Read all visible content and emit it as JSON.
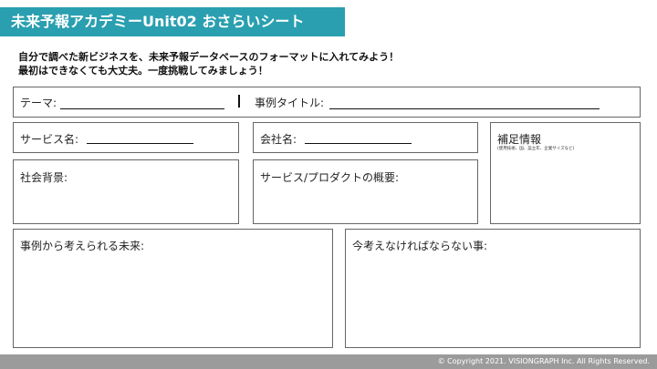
{
  "header": {
    "title": "未来予報アカデミーUnit02 おさらいシート"
  },
  "intro": {
    "line1": "自分で調べた新ビジネスを、未来予報データベースのフォーマットに入れてみよう！",
    "line2": "最初はできなくても大丈夫。一度挑戦してみましょう！"
  },
  "fields": {
    "theme": "テーマ:",
    "case_title": "事例タイトル:",
    "service_name": "サービス名:",
    "company_name": "会社名:",
    "supplement": "補足情報",
    "supplement_note": "(使用技術、国、設立年、企業サイズなど)",
    "social_background": "社会背景:",
    "service_overview": "サービス/プロダクトの概要:",
    "future": "事例から考えられる未来:",
    "think_now": "今考えなければならない事:"
  },
  "footer": {
    "copyright": "© Copyright 2021. VISIONGRAPH Inc. All Rights Reserved."
  }
}
